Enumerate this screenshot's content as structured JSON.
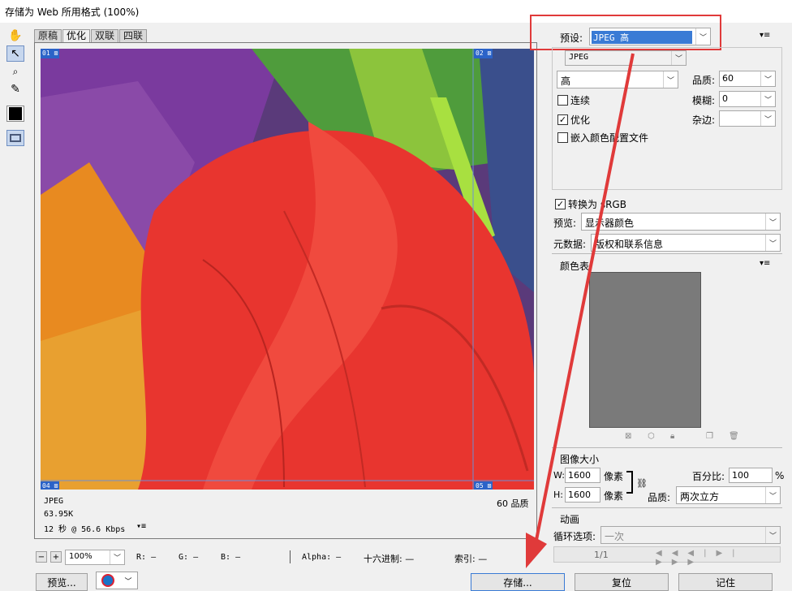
{
  "window": {
    "title": "存储为 Web 所用格式 (100%)"
  },
  "tools": [
    {
      "name": "hand-tool-icon",
      "glyph": "✋"
    },
    {
      "name": "slice-select-tool-icon",
      "glyph": "↖"
    },
    {
      "name": "zoom-tool-icon",
      "glyph": "🔍"
    },
    {
      "name": "eyedropper-tool-icon",
      "glyph": "✎"
    },
    {
      "name": "color-swatch",
      "glyph": ""
    },
    {
      "name": "toggle-slices-icon",
      "glyph": "▭"
    }
  ],
  "view_tabs": [
    "原稿",
    "优化",
    "双联",
    "四联"
  ],
  "selected_tab": "优化",
  "slices": [
    "01",
    "02",
    "04",
    "05"
  ],
  "image_info": {
    "format": "JPEG",
    "size": "63.95K",
    "time": "12 秒 @ 56.6 Kbps",
    "quality_text": "60 品质"
  },
  "bottom_bar": {
    "zoom": "100%",
    "r_label": "R:",
    "r_value": "—",
    "g_label": "G:",
    "g_value": "—",
    "b_label": "B:",
    "b_value": "—",
    "alpha_label": "Alpha:",
    "alpha_value": "—",
    "hex_label": "十六进制:",
    "hex_value": "—",
    "index_label": "索引:",
    "index_value": "—"
  },
  "buttons": {
    "preview": "预览...",
    "save": "存储...",
    "reset": "复位",
    "remember": "记住"
  },
  "settings": {
    "preset_label": "预设:",
    "preset_value": "JPEG 高",
    "format": "JPEG",
    "quality_preset": "高",
    "quality_label": "品质:",
    "quality_value": "60",
    "progressive_label": "连续",
    "blur_label": "模糊:",
    "blur_value": "0",
    "optimized_label": "优化",
    "matte_label": "杂边:",
    "matte_value": "",
    "embed_profile_label": "嵌入颜色配置文件",
    "convert_srgb_label": "转换为 sRGB",
    "preview_label": "预览:",
    "preview_value": "显示器颜色",
    "metadata_label": "元数据:",
    "metadata_value": "版权和联系信息"
  },
  "checkboxes": {
    "progressive": false,
    "optimized": true,
    "embed_profile": false,
    "convert_srgb": true
  },
  "color_table": {
    "title": "颜色表"
  },
  "image_size": {
    "title": "图像大小",
    "w_label": "W:",
    "w_value": "1600",
    "h_label": "H:",
    "h_value": "1600",
    "unit": "像素",
    "percent_label": "百分比:",
    "percent_value": "100",
    "percent_sign": "%",
    "quality_label": "品质:",
    "quality_value": "两次立方"
  },
  "animation": {
    "title": "动画",
    "loop_label": "循环选项:",
    "loop_value": "一次",
    "frame": "1/1"
  },
  "colors": {
    "highlight_red": "#e03a3a",
    "preset_select_bg": "#3a7bd5"
  }
}
